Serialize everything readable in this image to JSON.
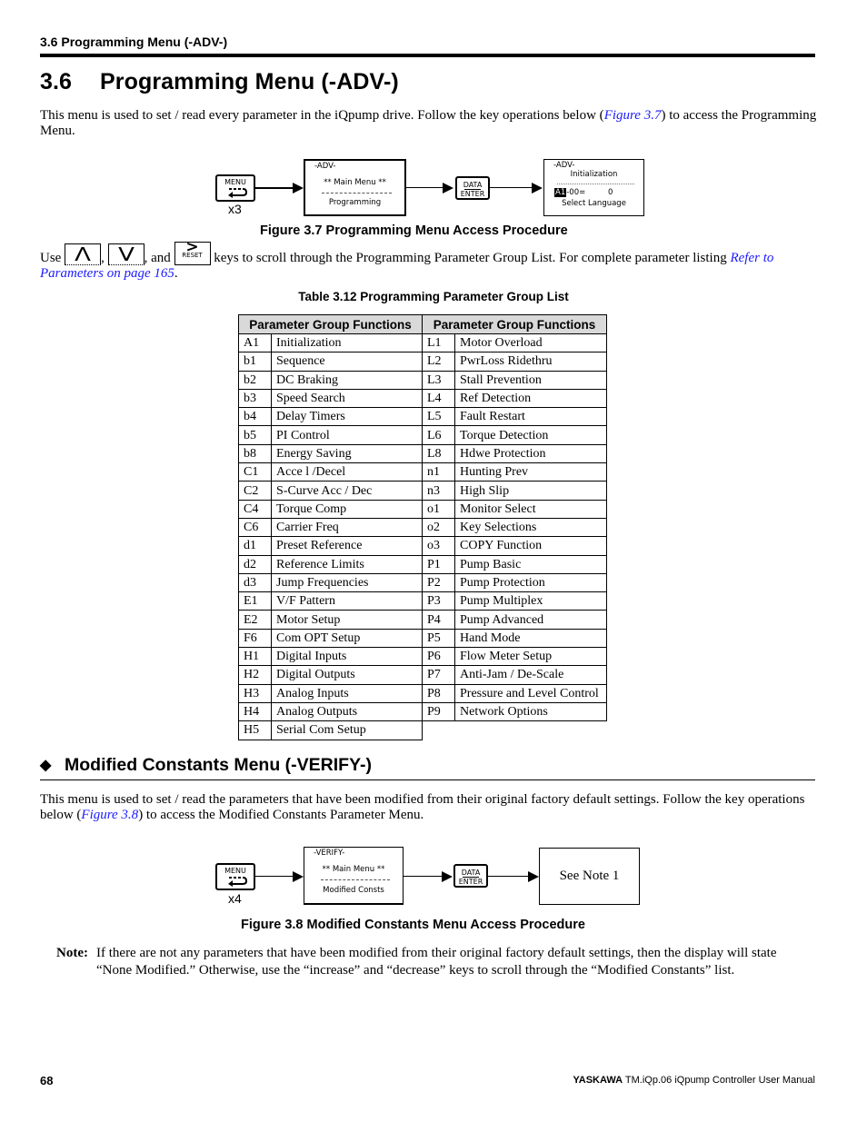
{
  "header": {
    "running_head": "3.6  Programming Menu (-ADV-)"
  },
  "section": {
    "number": "3.6",
    "title": "Programming Menu (-ADV-)",
    "intro": {
      "before": "This menu is used to set / read every parameter in the iQpump drive. Follow the key operations below (",
      "link": "Figure 3.7",
      "after": ") to access the Programming Menu."
    }
  },
  "figure_3_7": {
    "menu_key": {
      "label": "MENU",
      "icon": "return-arrow-icon",
      "multiplier": "x3"
    },
    "screen1": {
      "mode": "-ADV-",
      "line1": "** Main Menu **",
      "line2": "Programming"
    },
    "data_key": {
      "top": "DATA",
      "bottom": "ENTER"
    },
    "screen2": {
      "mode": "-ADV-",
      "line1": "Initialization",
      "param_highlight": "A1",
      "param_rest": "-00=",
      "value": "0",
      "line3": "Select Language"
    },
    "caption": "Figure 3.7  Programming Menu Access Procedure"
  },
  "use_para": {
    "use": "Use",
    "up_key": "Λ",
    "down_key": "V",
    "sep1": ",",
    "sep2": ", and",
    "reset_key": {
      "symbol": ">",
      "label": "RESET"
    },
    "text": "keys to scroll through the Programming Parameter Group List. For complete parameter listing",
    "link": "Refer to Parameters on page 165",
    "end": "."
  },
  "table": {
    "caption": "Table 3.12  Programming Parameter Group List",
    "headers": [
      "Parameter Group Functions",
      "Parameter Group Functions"
    ],
    "rows": [
      {
        "c1": "A1",
        "n1": "Initialization",
        "c2": "L1",
        "n2": "Motor Overload"
      },
      {
        "c1": "b1",
        "n1": "Sequence",
        "c2": "L2",
        "n2": "PwrLoss Ridethru"
      },
      {
        "c1": "b2",
        "n1": "DC Braking",
        "c2": "L3",
        "n2": "Stall Prevention"
      },
      {
        "c1": "b3",
        "n1": "Speed Search",
        "c2": "L4",
        "n2": "Ref Detection"
      },
      {
        "c1": "b4",
        "n1": "Delay Timers",
        "c2": "L5",
        "n2": "Fault Restart"
      },
      {
        "c1": "b5",
        "n1": "PI Control",
        "c2": "L6",
        "n2": "Torque Detection"
      },
      {
        "c1": "b8",
        "n1": "Energy Saving",
        "c2": "L8",
        "n2": "Hdwe Protection"
      },
      {
        "c1": "C1",
        "n1": "Acce l /Decel",
        "c2": "n1",
        "n2": "Hunting Prev"
      },
      {
        "c1": "C2",
        "n1": "S-Curve Acc / Dec",
        "c2": "n3",
        "n2": "High Slip"
      },
      {
        "c1": "C4",
        "n1": "Torque Comp",
        "c2": "o1",
        "n2": "Monitor Select"
      },
      {
        "c1": "C6",
        "n1": "Carrier Freq",
        "c2": "o2",
        "n2": "Key Selections"
      },
      {
        "c1": "d1",
        "n1": "Preset Reference",
        "c2": "o3",
        "n2": "COPY Function"
      },
      {
        "c1": "d2",
        "n1": "Reference Limits",
        "c2": "P1",
        "n2": "Pump Basic"
      },
      {
        "c1": "d3",
        "n1": "Jump Frequencies",
        "c2": "P2",
        "n2": "Pump Protection"
      },
      {
        "c1": "E1",
        "n1": "V/F Pattern",
        "c2": "P3",
        "n2": "Pump Multiplex"
      },
      {
        "c1": "E2",
        "n1": "Motor Setup",
        "c2": "P4",
        "n2": "Pump Advanced"
      },
      {
        "c1": "F6",
        "n1": "Com OPT Setup",
        "c2": "P5",
        "n2": "Hand Mode"
      },
      {
        "c1": "H1",
        "n1": "Digital Inputs",
        "c2": "P6",
        "n2": "Flow Meter Setup"
      },
      {
        "c1": "H2",
        "n1": "Digital Outputs",
        "c2": "P7",
        "n2": "Anti-Jam / De-Scale"
      },
      {
        "c1": "H3",
        "n1": "Analog Inputs",
        "c2": "P8",
        "n2": "Pressure and Level Control"
      },
      {
        "c1": "H4",
        "n1": "Analog Outputs",
        "c2": "P9",
        "n2": "Network Options"
      },
      {
        "c1": "H5",
        "n1": "Serial Com Setup",
        "c2": "",
        "n2": ""
      }
    ]
  },
  "subsection": {
    "bullet": "◆",
    "title": "Modified Constants Menu (-VERIFY-)",
    "intro": {
      "before": "This menu is used to set / read the parameters that have been modified from their original factory default settings. Follow the key operations below (",
      "link": "Figure 3.8",
      "after": ") to access the Modified Constants Parameter Menu."
    }
  },
  "figure_3_8": {
    "menu_key": {
      "label": "MENU",
      "icon": "return-arrow-icon",
      "multiplier": "x4"
    },
    "screen1": {
      "mode": "-VERIFY-",
      "line1": "** Main Menu **",
      "line2": "Modified Consts"
    },
    "data_key": {
      "top": "DATA",
      "bottom": "ENTER"
    },
    "result": "See Note 1",
    "caption": "Figure 3.8  Modified Constants Menu Access Procedure"
  },
  "note": {
    "label": "Note:",
    "text": "If there are not any parameters that have been modified from their original factory default settings, then the display will state “None Modified.” Otherwise, use the “increase” and “decrease” keys to scroll through the “Modified Constants” list."
  },
  "footer": {
    "page_number": "68",
    "brand": "YASKAWA",
    "doc_title": "TM.iQp.06 iQpump Controller User Manual"
  }
}
